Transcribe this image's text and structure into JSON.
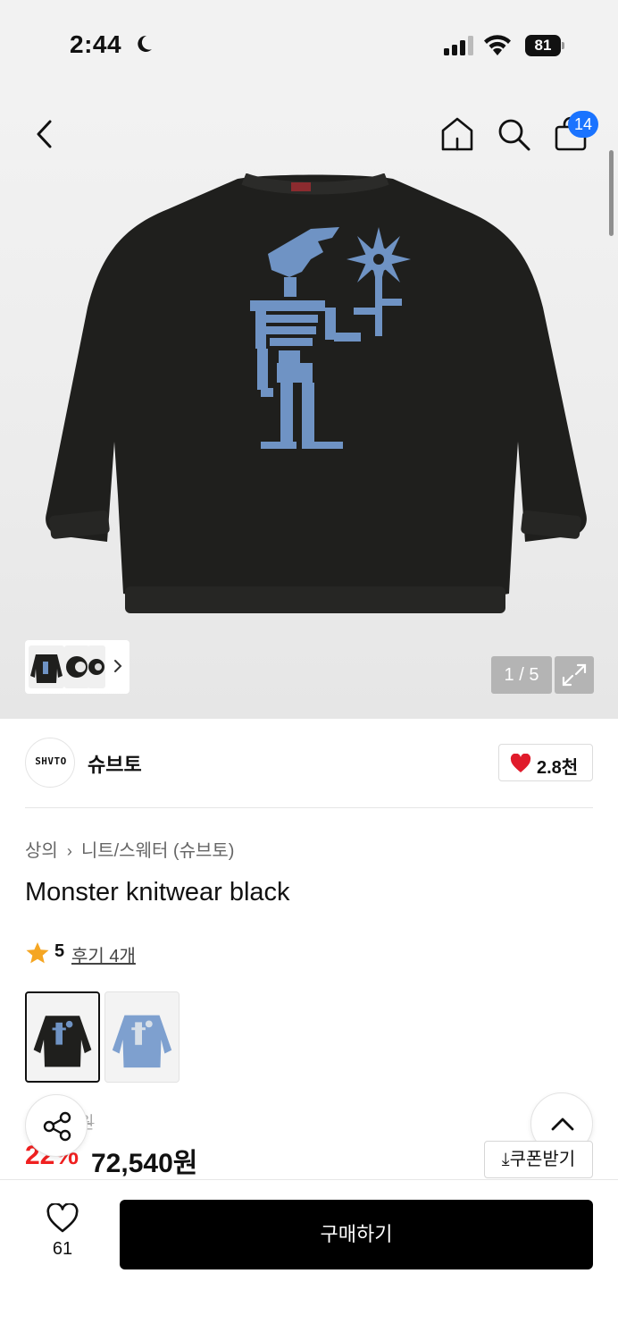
{
  "status_bar": {
    "time": "2:44",
    "battery": "81"
  },
  "header": {
    "cart_count": "14"
  },
  "gallery": {
    "counter": "1 / 5"
  },
  "brand": {
    "logo_text": "SHVTO",
    "name": "슈브토",
    "likes": "2.8천"
  },
  "breadcrumb": {
    "category": "상의",
    "subcategory": "니트/스웨터 (슈브토)"
  },
  "product": {
    "title": "Monster knitwear black",
    "rating": "5",
    "review_label": "후기 4개",
    "original_price": "원",
    "discount": "22%",
    "price": "72,540원"
  },
  "actions": {
    "coupon_label": "⤓쿠폰받기",
    "wish_count": "61",
    "buy_label": "구매하기"
  },
  "colors": {
    "accent_blue": "#1a73ff",
    "discount_red": "#f02020",
    "heart_red": "#e01b2b",
    "star_yellow": "#f5a623",
    "sweater_black": "#1f1f1d",
    "skeleton_blue": "#6f93c4",
    "sweater_blue": "#7ea0cf"
  }
}
